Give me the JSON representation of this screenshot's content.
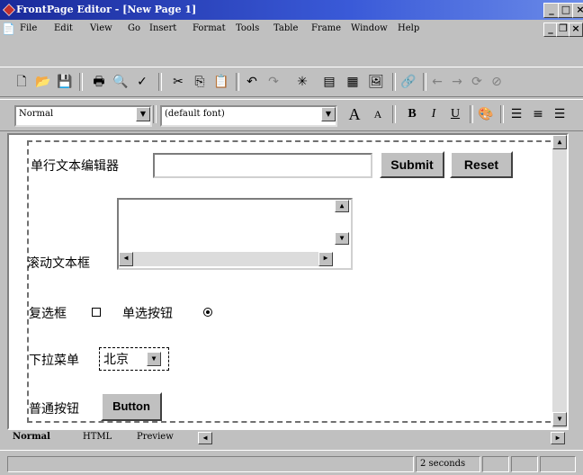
{
  "window": {
    "title": "FrontPage Editor - [New Page 1]"
  },
  "menu": [
    "File",
    "Edit",
    "View",
    "Go",
    "Insert",
    "Format",
    "Tools",
    "Table",
    "Frame",
    "Window",
    "Help"
  ],
  "format_bar": {
    "style": "Normal",
    "font": "(default font)",
    "bold": "B",
    "italic": "I",
    "underline": "U"
  },
  "form": {
    "textline_label": "单行文本编辑器",
    "submit_label": "Submit",
    "reset_label": "Reset",
    "textarea_label": "滚动文本框",
    "checkbox_label": "复选框",
    "radio_label": "单选按钮",
    "dropdown_label": "下拉菜单",
    "dropdown_value": "北京",
    "pushbutton_label": "普通按钮",
    "button_text": "Button"
  },
  "tabs": [
    "Normal",
    "HTML",
    "Preview"
  ],
  "status": {
    "load_time": "2 seconds"
  }
}
